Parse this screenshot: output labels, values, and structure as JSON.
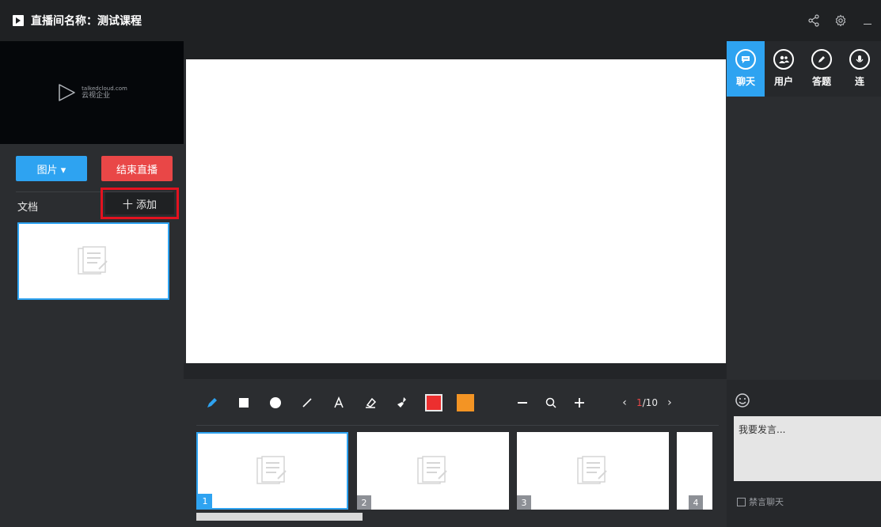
{
  "window": {
    "title": "直播间名称：测试课程"
  },
  "left": {
    "logo": {
      "line1": "talkedcloud.com",
      "line2": "云视企业"
    },
    "image_button": "图片 ▾",
    "end_live_button": "结束直播",
    "doc_label": "文档",
    "add_button": "十 添加"
  },
  "toolbar": {
    "page_current": "1",
    "page_total": "/10"
  },
  "thumbs": [
    {
      "num": "1"
    },
    {
      "num": "2"
    },
    {
      "num": "3"
    },
    {
      "num": "4"
    }
  ],
  "right": {
    "tabs": [
      {
        "label": "聊天",
        "icon": "chat-bubble-icon"
      },
      {
        "label": "用户",
        "icon": "users-icon"
      },
      {
        "label": "答题",
        "icon": "pencil-icon"
      },
      {
        "label": "连",
        "icon": "microphone-icon"
      }
    ],
    "chat_placeholder": "我要发言...",
    "mute_label": "禁言聊天"
  },
  "colors": {
    "accent": "#2ea3f1",
    "danger": "#e94747",
    "highlight": "#e3121f",
    "swatch_orange": "#f39424"
  }
}
